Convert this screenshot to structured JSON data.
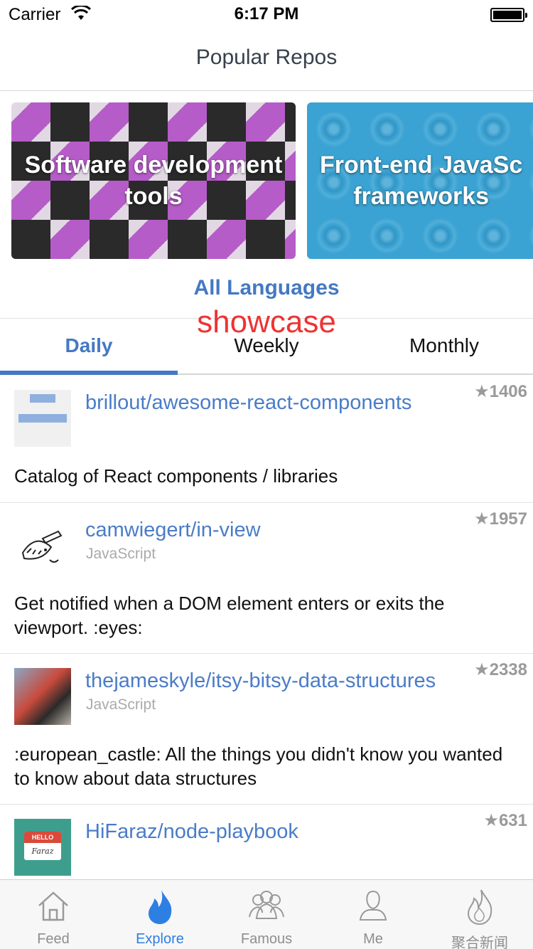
{
  "status_bar": {
    "carrier": "Carrier",
    "time": "6:17 PM"
  },
  "nav": {
    "title": "Popular Repos"
  },
  "banners": [
    {
      "line1": "Software development",
      "line2": "tools"
    },
    {
      "line1": "Front-end JavaSc",
      "line2": "frameworks"
    }
  ],
  "language": "All Languages",
  "showcase": "showcase",
  "tabs": [
    {
      "label": "Daily",
      "active": true
    },
    {
      "label": "Weekly",
      "active": false
    },
    {
      "label": "Monthly",
      "active": false
    }
  ],
  "repos": [
    {
      "name": "brillout/awesome-react-components",
      "stars": "★1406",
      "language": "",
      "description": "Catalog of React components / libraries"
    },
    {
      "name": "camwiegert/in-view",
      "stars": "★1957",
      "language": "JavaScript",
      "description": "Get notified when a DOM element enters or exits the viewport. :eyes:"
    },
    {
      "name": "thejameskyle/itsy-bitsy-data-structures",
      "stars": "★2338",
      "language": "JavaScript",
      "description": ":european_castle: All the things you didn't know you wanted to know about data structures"
    },
    {
      "name": "HiFaraz/node-playbook",
      "stars": "★631",
      "language": "",
      "description": "",
      "avatar_text_top": "HELLO",
      "avatar_text_name": "Faraz"
    }
  ],
  "tabbar": [
    {
      "label": "Feed",
      "icon": "house-icon",
      "active": false
    },
    {
      "label": "Explore",
      "icon": "flame-icon",
      "active": true
    },
    {
      "label": "Famous",
      "icon": "people-icon",
      "active": false
    },
    {
      "label": "Me",
      "icon": "person-icon",
      "active": false
    },
    {
      "label": "聚合新闻",
      "icon": "flame-outline-icon",
      "active": false
    }
  ],
  "colors": {
    "accent": "#4478c4",
    "showcase": "#ee3333",
    "tab_active": "#2d7fe3"
  }
}
